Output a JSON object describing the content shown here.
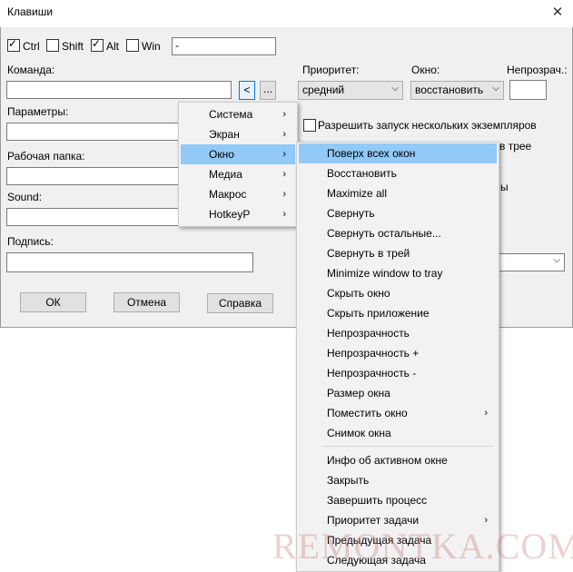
{
  "window": {
    "title": "Клавиши",
    "close_glyph": "✕"
  },
  "modifiers": [
    {
      "label": "Ctrl",
      "checked": true
    },
    {
      "label": "Shift",
      "checked": false
    },
    {
      "label": "Alt",
      "checked": true
    },
    {
      "label": "Win",
      "checked": false
    }
  ],
  "hotkey_value": "-",
  "command": {
    "label": "Команда:",
    "value": "",
    "insert_button": "<",
    "browse_button": "..."
  },
  "priority": {
    "label": "Приоритет:",
    "value": "средний"
  },
  "window_mode": {
    "label": "Окно:",
    "value": "восстановить"
  },
  "opacity": {
    "label": "Непрозрач.:",
    "value": ""
  },
  "allow_multiple": {
    "label": "Разрешить запуск нескольких экземпляров",
    "checked": false
  },
  "partial_text": {
    "tray_fragment": "в трее",
    "right_fragment": "ы"
  },
  "params": {
    "label": "Параметры:",
    "value": ""
  },
  "workdir": {
    "label": "Рабочая папка:",
    "value": ""
  },
  "sound": {
    "label": "Sound:",
    "value": ""
  },
  "caption": {
    "label": "Подпись:",
    "value": ""
  },
  "buttons": {
    "ok": "ОК",
    "cancel": "Отмена",
    "help": "Справка"
  },
  "context_menu": {
    "items": [
      "Система",
      "Экран",
      "Окно",
      "Медиа",
      "Макрос",
      "HotkeyP"
    ],
    "highlighted": "Окно"
  },
  "submenu": {
    "group1": [
      "Поверх всех окон",
      "Восстановить",
      "Maximize all",
      "Свернуть",
      "Свернуть остальные...",
      "Свернуть в трей",
      "Minimize window to tray",
      "Скрыть окно",
      "Скрыть приложение",
      "Непрозрачность",
      "Непрозрачность +",
      "Непрозрачность -",
      "Размер окна",
      "Поместить окно",
      "Снимок окна"
    ],
    "group2": [
      "Инфо об активном окне",
      "Закрыть",
      "Завершить процесс",
      "Приоритет задачи",
      "Предыдущая задача",
      "Следующая задача"
    ],
    "highlighted": "Поверх всех окон",
    "has_submenu": [
      "Поместить окно",
      "Приоритет задачи"
    ]
  },
  "icons": {
    "submenu_arrow": "›",
    "dropdown_arrow": "⌵"
  },
  "watermark": "REMONTKA.COM"
}
